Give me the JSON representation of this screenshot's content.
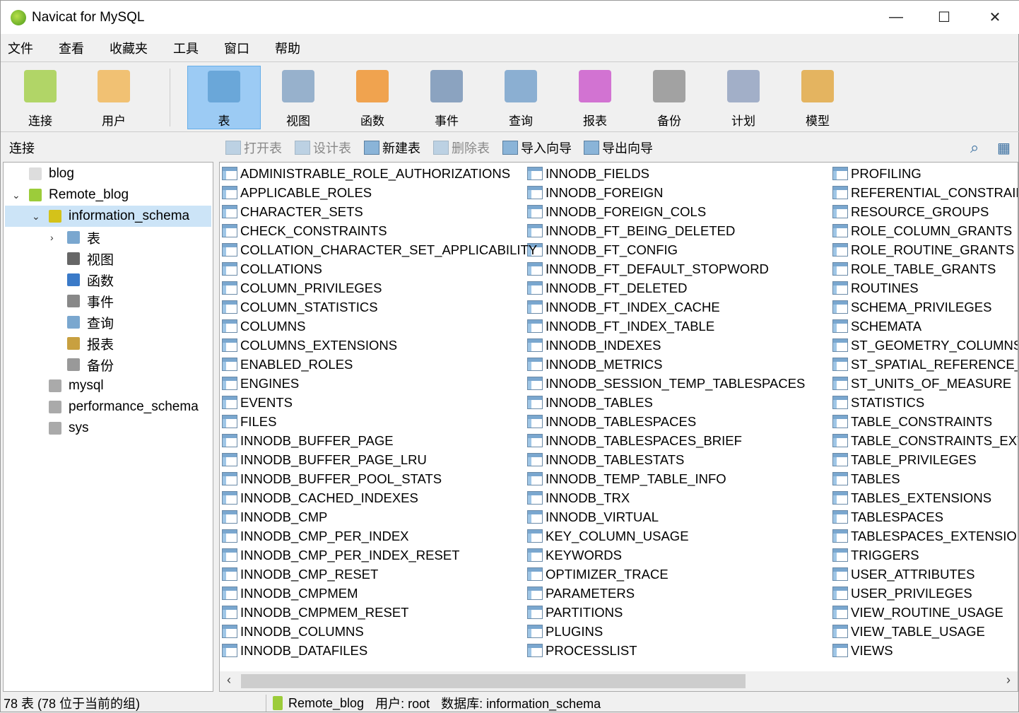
{
  "window": {
    "title": "Navicat for MySQL",
    "minimize": "—",
    "maximize": "☐",
    "close": "✕"
  },
  "menu": [
    "文件",
    "查看",
    "收藏夹",
    "工具",
    "窗口",
    "帮助"
  ],
  "toolbar": [
    {
      "label": "连接",
      "color": "#9ccc3a"
    },
    {
      "label": "用户",
      "color": "#f2b24a"
    },
    {
      "label": "表",
      "color": "#5a9bd0"
    },
    {
      "label": "视图",
      "color": "#7a9cc0"
    },
    {
      "label": "函数",
      "color": "#f08a1a"
    },
    {
      "label": "事件",
      "color": "#6a8ab0"
    },
    {
      "label": "查询",
      "color": "#6a9ac8"
    },
    {
      "label": "报表",
      "color": "#c84ac8"
    },
    {
      "label": "备份",
      "color": "#888888"
    },
    {
      "label": "计划",
      "color": "#8899bb"
    },
    {
      "label": "模型",
      "color": "#e0a030"
    }
  ],
  "subbar": {
    "connection_label": "连接",
    "actions": [
      {
        "label": "打开表",
        "enabled": false
      },
      {
        "label": "设计表",
        "enabled": false
      },
      {
        "label": "新建表",
        "enabled": true
      },
      {
        "label": "删除表",
        "enabled": false
      },
      {
        "label": "导入向导",
        "enabled": true
      },
      {
        "label": "导出向导",
        "enabled": true
      }
    ],
    "search_icon": "search-icon",
    "grid_icon": "grid-view-icon"
  },
  "tree": [
    {
      "label": "blog",
      "level": 0,
      "icon": "connection-icon",
      "expanded": null
    },
    {
      "label": "Remote_blog",
      "level": 0,
      "icon": "connection-icon",
      "expanded": true
    },
    {
      "label": "information_schema",
      "level": 1,
      "icon": "database-icon",
      "expanded": true,
      "selected": true
    },
    {
      "label": "表",
      "level": 2,
      "icon": "table-icon",
      "expanded": false
    },
    {
      "label": "视图",
      "level": 2,
      "icon": "view-icon"
    },
    {
      "label": "函数",
      "level": 2,
      "icon": "function-icon"
    },
    {
      "label": "事件",
      "level": 2,
      "icon": "event-icon"
    },
    {
      "label": "查询",
      "level": 2,
      "icon": "query-icon"
    },
    {
      "label": "报表",
      "level": 2,
      "icon": "report-icon"
    },
    {
      "label": "备份",
      "level": 2,
      "icon": "backup-icon"
    },
    {
      "label": "mysql",
      "level": 1,
      "icon": "database-icon"
    },
    {
      "label": "performance_schema",
      "level": 1,
      "icon": "database-icon"
    },
    {
      "label": "sys",
      "level": 1,
      "icon": "database-icon"
    }
  ],
  "tables": [
    [
      "ADMINISTRABLE_ROLE_AUTHORIZATIONS",
      "APPLICABLE_ROLES",
      "CHARACTER_SETS",
      "CHECK_CONSTRAINTS",
      "COLLATION_CHARACTER_SET_APPLICABILITY",
      "COLLATIONS",
      "COLUMN_PRIVILEGES",
      "COLUMN_STATISTICS",
      "COLUMNS",
      "COLUMNS_EXTENSIONS",
      "ENABLED_ROLES",
      "ENGINES",
      "EVENTS",
      "FILES",
      "INNODB_BUFFER_PAGE",
      "INNODB_BUFFER_PAGE_LRU",
      "INNODB_BUFFER_POOL_STATS",
      "INNODB_CACHED_INDEXES",
      "INNODB_CMP",
      "INNODB_CMP_PER_INDEX",
      "INNODB_CMP_PER_INDEX_RESET",
      "INNODB_CMP_RESET",
      "INNODB_CMPMEM",
      "INNODB_CMPMEM_RESET",
      "INNODB_COLUMNS",
      "INNODB_DATAFILES"
    ],
    [
      "INNODB_FIELDS",
      "INNODB_FOREIGN",
      "INNODB_FOREIGN_COLS",
      "INNODB_FT_BEING_DELETED",
      "INNODB_FT_CONFIG",
      "INNODB_FT_DEFAULT_STOPWORD",
      "INNODB_FT_DELETED",
      "INNODB_FT_INDEX_CACHE",
      "INNODB_FT_INDEX_TABLE",
      "INNODB_INDEXES",
      "INNODB_METRICS",
      "INNODB_SESSION_TEMP_TABLESPACES",
      "INNODB_TABLES",
      "INNODB_TABLESPACES",
      "INNODB_TABLESPACES_BRIEF",
      "INNODB_TABLESTATS",
      "INNODB_TEMP_TABLE_INFO",
      "INNODB_TRX",
      "INNODB_VIRTUAL",
      "KEY_COLUMN_USAGE",
      "KEYWORDS",
      "OPTIMIZER_TRACE",
      "PARAMETERS",
      "PARTITIONS",
      "PLUGINS",
      "PROCESSLIST"
    ],
    [
      "PROFILING",
      "REFERENTIAL_CONSTRAIN",
      "RESOURCE_GROUPS",
      "ROLE_COLUMN_GRANTS",
      "ROLE_ROUTINE_GRANTS",
      "ROLE_TABLE_GRANTS",
      "ROUTINES",
      "SCHEMA_PRIVILEGES",
      "SCHEMATA",
      "ST_GEOMETRY_COLUMNS",
      "ST_SPATIAL_REFERENCE_SY",
      "ST_UNITS_OF_MEASURE",
      "STATISTICS",
      "TABLE_CONSTRAINTS",
      "TABLE_CONSTRAINTS_EXTI",
      "TABLE_PRIVILEGES",
      "TABLES",
      "TABLES_EXTENSIONS",
      "TABLESPACES",
      "TABLESPACES_EXTENSION",
      "TRIGGERS",
      "USER_ATTRIBUTES",
      "USER_PRIVILEGES",
      "VIEW_ROUTINE_USAGE",
      "VIEW_TABLE_USAGE",
      "VIEWS"
    ]
  ],
  "status": {
    "count": "78 表 (78 位于当前的组)",
    "connection": "Remote_blog",
    "user": "用户: root",
    "database": "数据库: information_schema"
  },
  "scroll": {
    "left": "‹",
    "right": "›"
  }
}
